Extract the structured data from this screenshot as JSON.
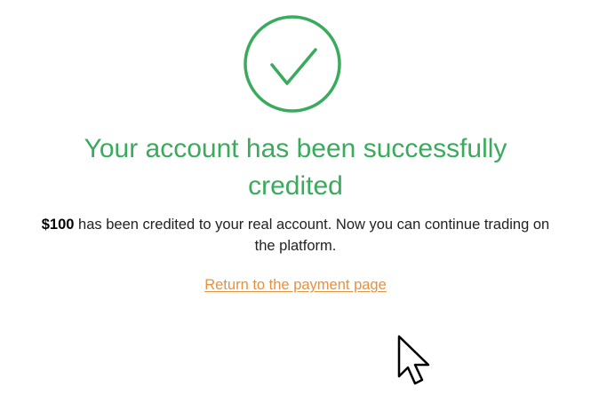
{
  "success": {
    "icon": "check-circle-icon",
    "title": "Your account has been successfully credited",
    "amount": "$100",
    "message": " has been credited to your real account. Now you can continue trading on the platform.",
    "return_link": "Return to the payment page"
  },
  "cursor": {
    "icon": "mouse-pointer-icon"
  },
  "colors": {
    "success_green": "#3aab5c",
    "link_orange": "#e8913a",
    "text": "#222222"
  }
}
